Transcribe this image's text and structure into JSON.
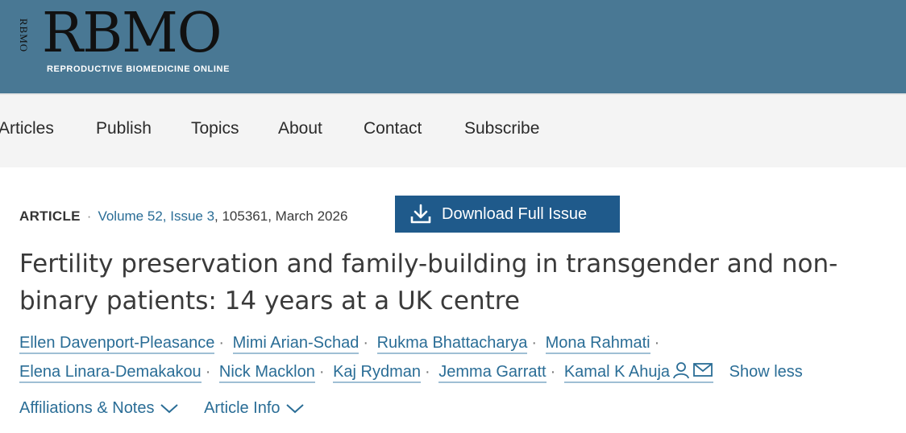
{
  "brand": {
    "logo_vertical": "RBMO",
    "logo": "RBMO",
    "subtitle": "REPRODUCTIVE BIOMEDICINE ONLINE",
    "banner_color": "#497894"
  },
  "nav": {
    "items": [
      "Articles",
      "Publish",
      "Topics",
      "About",
      "Contact",
      "Subscribe"
    ]
  },
  "article": {
    "type": "ARTICLE",
    "volume_link": "Volume 52, Issue 3",
    "meta_rest": ", 105361, March 2026",
    "download_label": "Download Full Issue",
    "title": "Fertility preservation and family-building in transgender and non-binary patients: 14 years at a UK centre",
    "authors": [
      "Ellen Davenport-Pleasance",
      "Mimi Arian-Schad",
      "Rukma Bhattacharya",
      "Mona Rahmati",
      "Elena Linara-Demakakou",
      "Nick Macklon",
      "Kaj Rydman",
      "Jemma Garratt",
      "Kamal K Ahuja"
    ],
    "show_less": "Show less",
    "affiliations_label": "Affiliations & Notes",
    "article_info_label": "Article Info",
    "link_color": "#2a6d96",
    "button_color": "#1f5a8b"
  }
}
